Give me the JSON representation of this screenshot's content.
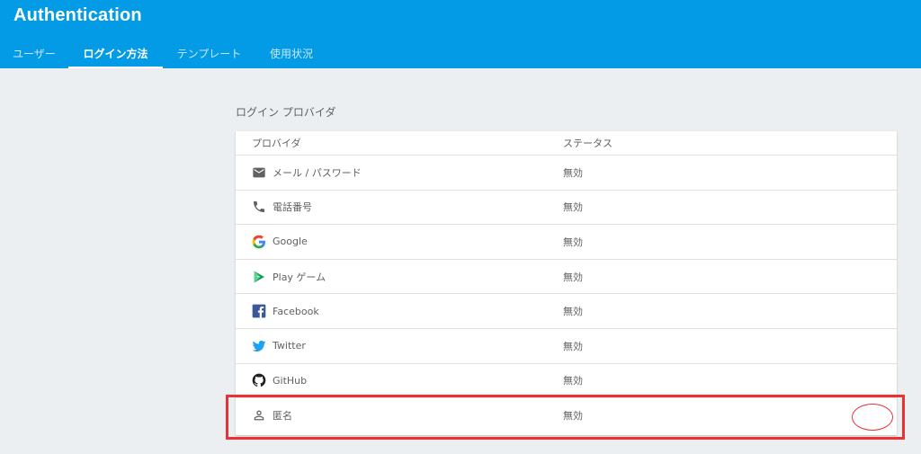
{
  "app": {
    "title": "Authentication"
  },
  "tabs": [
    {
      "label": "ユーザー"
    },
    {
      "label": "ログイン方法"
    },
    {
      "label": "テンプレート"
    },
    {
      "label": "使用状況"
    }
  ],
  "section": {
    "title": "ログイン プロバイダ"
  },
  "table": {
    "headers": {
      "provider": "プロバイダ",
      "status": "ステータス"
    },
    "rows": [
      {
        "icon": "mail-icon",
        "name": "メール / パスワード",
        "status": "無効"
      },
      {
        "icon": "phone-icon",
        "name": "電話番号",
        "status": "無効"
      },
      {
        "icon": "google-icon",
        "name": "Google",
        "status": "無効"
      },
      {
        "icon": "play-games-icon",
        "name": "Play ゲーム",
        "status": "無効"
      },
      {
        "icon": "facebook-icon",
        "name": "Facebook",
        "status": "無効"
      },
      {
        "icon": "twitter-icon",
        "name": "Twitter",
        "status": "無効"
      },
      {
        "icon": "github-icon",
        "name": "GitHub",
        "status": "無効"
      },
      {
        "icon": "person-icon",
        "name": "匿名",
        "status": "無効"
      }
    ]
  },
  "colors": {
    "appbar": "#039be5",
    "annotation": "#f03030",
    "background": "#eceff1"
  }
}
